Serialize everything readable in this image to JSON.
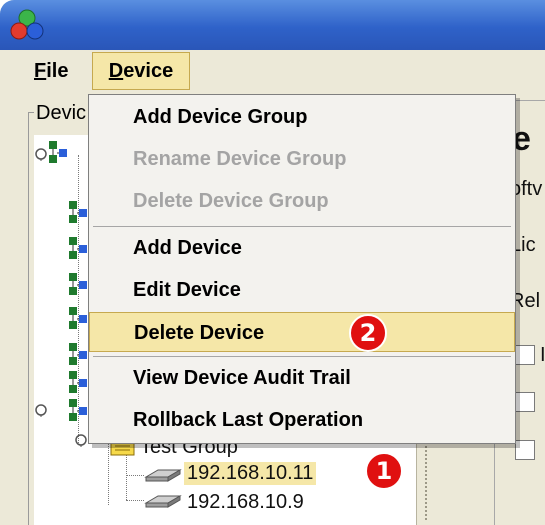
{
  "menubar": {
    "file_label": "File",
    "file_mnemonic": "F",
    "file_rest": "ile",
    "device_label": "Device",
    "device_mnemonic": "D",
    "device_rest": "evice"
  },
  "left_panel": {
    "group_title": "Devic"
  },
  "device_menu": {
    "items": [
      {
        "label": "Add Device Group",
        "enabled": true
      },
      {
        "label": "Rename Device Group",
        "enabled": false
      },
      {
        "label": "Delete Device Group",
        "enabled": false
      },
      {
        "label": "Add Device",
        "enabled": true
      },
      {
        "label": "Edit Device",
        "enabled": true
      },
      {
        "label": "Delete Device",
        "enabled": true,
        "highlighted": true
      },
      {
        "label": "View Device Audit Trail",
        "enabled": true
      },
      {
        "label": "Rollback Last Operation",
        "enabled": true
      }
    ]
  },
  "tree": {
    "group_label": "Test Group",
    "devices": [
      "192.168.10.11",
      "192.168.10.9"
    ],
    "selected_index": 0
  },
  "right_panel": {
    "title": "e",
    "text_1": "oftv",
    "text_2": "Lic",
    "text_3": "Rel",
    "text_4": "I"
  },
  "callouts": {
    "badge_1": "1",
    "badge_2": "2"
  },
  "colors": {
    "highlight": "#f5e7a8",
    "badge": "#e01010",
    "disabled_text": "#a4a4a4"
  },
  "icons": [
    "app-logo-icon",
    "network-group-icon",
    "folder-icon",
    "host-device-icon",
    "tree-expander-icon"
  ]
}
